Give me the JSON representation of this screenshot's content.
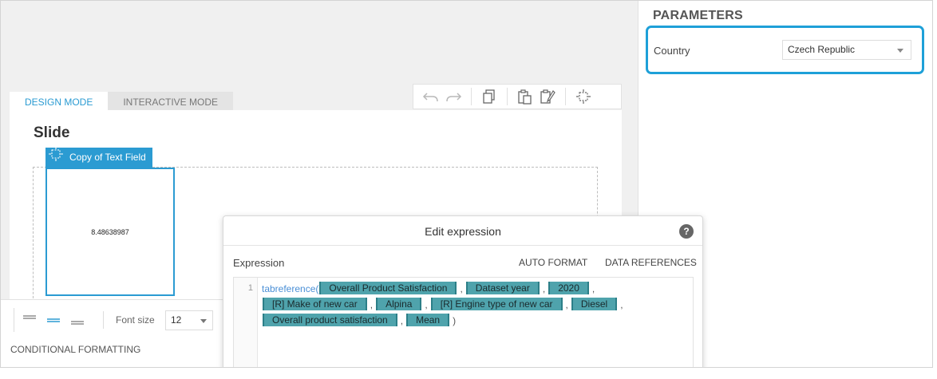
{
  "design": {
    "tabs": [
      {
        "label": "DESIGN MODE",
        "active": true
      },
      {
        "label": "INTERACTIVE MODE",
        "active": false
      }
    ],
    "toolbar": {
      "icons": [
        "undo-icon",
        "redo-icon",
        "copy-icon",
        "paste-icon",
        "paste-format-icon",
        "select-area-icon"
      ]
    },
    "slide_title": "Slide",
    "field": {
      "label": "Copy of Text Field",
      "value": "8.48638987"
    }
  },
  "format_panel": {
    "font_size_label": "Font size",
    "font_size_value": "12",
    "conditional_formatting_label": "CONDITIONAL FORMATTING",
    "alignment_options": [
      "align-top",
      "align-middle",
      "align-bottom"
    ],
    "selected_alignment": "align-middle"
  },
  "parameters": {
    "title": "PARAMETERS",
    "items": [
      {
        "name": "Country",
        "value": "Czech Republic"
      }
    ],
    "highlight_color": "#1ea0d8"
  },
  "dialog": {
    "title": "Edit expression",
    "help": "?",
    "expression_label": "Expression",
    "auto_format_label": "AUTO FORMAT",
    "data_references_label": "DATA REFERENCES",
    "line_number": "1",
    "function_name": "tabreference(",
    "tokens": [
      "Overall Product Satisfaction",
      "Dataset year",
      "2020",
      "[R] Make of new car",
      "Alpina",
      "[R] Engine type of new car",
      "Diesel",
      "Overall product satisfaction",
      "Mean"
    ],
    "closing": ")"
  },
  "colors": {
    "accent": "#2b9bd2",
    "token_bg": "#4fa3ac"
  }
}
